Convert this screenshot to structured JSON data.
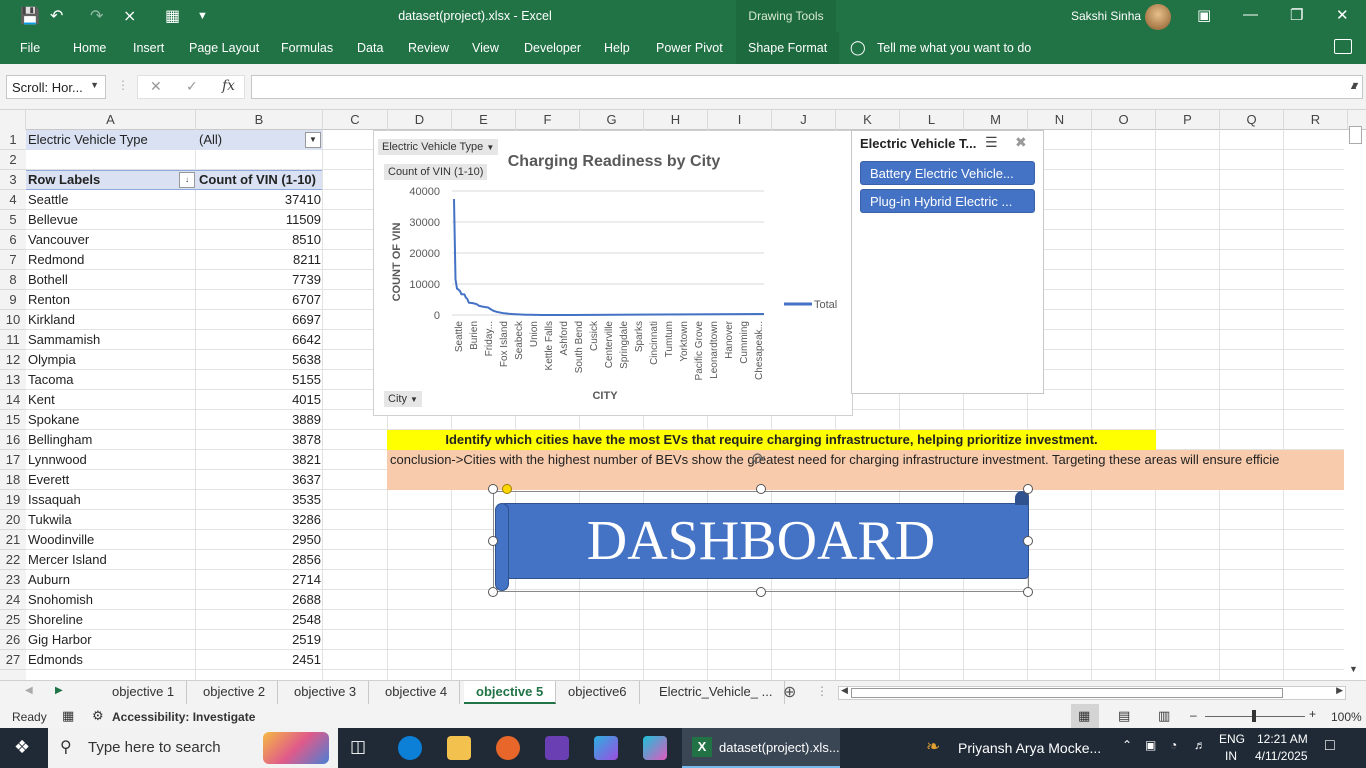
{
  "app": {
    "doc_title": "dataset(project).xlsx  -  Excel",
    "drawing_tools": "Drawing Tools",
    "user": "Sakshi Sinha"
  },
  "ribbon": {
    "tabs": [
      "File",
      "Home",
      "Insert",
      "Page Layout",
      "Formulas",
      "Data",
      "Review",
      "View",
      "Developer",
      "Help",
      "Power Pivot",
      "Shape Format"
    ],
    "tell_me": "Tell me what you want to do"
  },
  "formula_bar": {
    "name_box": "Scroll: Hor...",
    "fx": "fx",
    "content": ""
  },
  "columns": [
    "A",
    "B",
    "C",
    "D",
    "E",
    "F",
    "G",
    "H",
    "I",
    "J",
    "K",
    "L",
    "M",
    "N",
    "O",
    "P",
    "Q",
    "R"
  ],
  "rows": [
    "1",
    "2",
    "3",
    "4",
    "5",
    "6",
    "7",
    "8",
    "9",
    "10",
    "11",
    "12",
    "13",
    "14",
    "15",
    "16",
    "17",
    "18",
    "19",
    "20",
    "21",
    "22",
    "23",
    "24",
    "25",
    "26",
    "27"
  ],
  "pivot": {
    "filter_label": "Electric Vehicle Type",
    "filter_value": "(All)",
    "row_labels_header": "Row Labels",
    "value_header": "Count of VIN (1-10)",
    "rows": [
      {
        "city": "Seattle",
        "count": "37410"
      },
      {
        "city": "Bellevue",
        "count": "11509"
      },
      {
        "city": "Vancouver",
        "count": "8510"
      },
      {
        "city": "Redmond",
        "count": "8211"
      },
      {
        "city": "Bothell",
        "count": "7739"
      },
      {
        "city": "Renton",
        "count": "6707"
      },
      {
        "city": "Kirkland",
        "count": "6697"
      },
      {
        "city": "Sammamish",
        "count": "6642"
      },
      {
        "city": "Olympia",
        "count": "5638"
      },
      {
        "city": "Tacoma",
        "count": "5155"
      },
      {
        "city": "Kent",
        "count": "4015"
      },
      {
        "city": "Spokane",
        "count": "3889"
      },
      {
        "city": "Bellingham",
        "count": "3878"
      },
      {
        "city": "Lynnwood",
        "count": "3821"
      },
      {
        "city": "Everett",
        "count": "3637"
      },
      {
        "city": "Issaquah",
        "count": "3535"
      },
      {
        "city": "Tukwila",
        "count": "3286"
      },
      {
        "city": "Woodinville",
        "count": "2950"
      },
      {
        "city": "Mercer Island",
        "count": "2856"
      },
      {
        "city": "Auburn",
        "count": "2714"
      },
      {
        "city": "Snohomish",
        "count": "2688"
      },
      {
        "city": "Shoreline",
        "count": "2548"
      },
      {
        "city": "Gig Harbor",
        "count": "2519"
      },
      {
        "city": "Edmonds",
        "count": "2451"
      }
    ]
  },
  "chart_data": {
    "type": "line",
    "title": "Charging Readiness by City",
    "xlabel": "CITY",
    "ylabel": "COUNT OF VIN",
    "ylim": [
      0,
      40000
    ],
    "y_ticks": [
      "40000",
      "30000",
      "20000",
      "10000",
      "0"
    ],
    "x_tick_labels": [
      "Seattle",
      "Burien",
      "Friday...",
      "Fox Island",
      "Seabeck",
      "Union",
      "Kettle Falls",
      "Ashford",
      "South Bend",
      "Cusick",
      "Centerville",
      "Springdale",
      "Sparks",
      "Cincinnati",
      "Tumtum",
      "Yorktown",
      "Pacific Grove",
      "Leonardtown",
      "Hanover",
      "Cumming",
      "Chesapeak..."
    ],
    "series": [
      {
        "name": "Total",
        "values": [
          37410,
          11509,
          8510,
          8211,
          7739,
          6707,
          6697,
          6642,
          5638,
          5155,
          4015,
          3889,
          3878,
          3821,
          3637,
          3535,
          3286,
          2950,
          2856,
          2714,
          2688,
          2548,
          2519,
          2451,
          2100,
          1800,
          1500,
          1300,
          1150,
          1000,
          900,
          800,
          700,
          620,
          560,
          500,
          450,
          400,
          360,
          320,
          290,
          260,
          230,
          200,
          180,
          160,
          140,
          120,
          100,
          90,
          80,
          70,
          60,
          50,
          40,
          30,
          25,
          20,
          15,
          12,
          10,
          8,
          6,
          5,
          4,
          3,
          2,
          2,
          1,
          1,
          1,
          1,
          1,
          1,
          1,
          1,
          1,
          1,
          1,
          1
        ]
      }
    ],
    "field_buttons": {
      "filter": "Electric Vehicle Type",
      "value": "Count of VIN (1-10)",
      "axis": "City"
    },
    "legend_position": "right"
  },
  "slicer": {
    "title": "Electric Vehicle T...",
    "items": [
      "Battery Electric Vehicle...",
      "Plug-in Hybrid Electric ..."
    ]
  },
  "notes": {
    "objective": "Identify which cities have the most EVs that require charging infrastructure, helping prioritize investment.",
    "conclusion": "conclusion->Cities with the highest number of BEVs show the greatest need for charging infrastructure investment. Targeting these areas will ensure efficie"
  },
  "shape": {
    "text": "DASHBOARD"
  },
  "sheets": {
    "tabs": [
      "objective 1",
      "objective 2",
      "objective 3",
      "objective 4",
      "objective 5",
      "objective6",
      "Electric_Vehicle_ ..."
    ],
    "active": "objective 5"
  },
  "status": {
    "ready": "Ready",
    "accessibility": "Accessibility: Investigate",
    "zoom": "100%"
  },
  "taskbar": {
    "search_placeholder": "Type here to search",
    "excel_item": "dataset(project).xls...",
    "other_item": "Priyansh Arya Mocke...",
    "lang1": "ENG",
    "lang2": "IN",
    "time": "12:21 AM",
    "date": "4/11/2025"
  }
}
